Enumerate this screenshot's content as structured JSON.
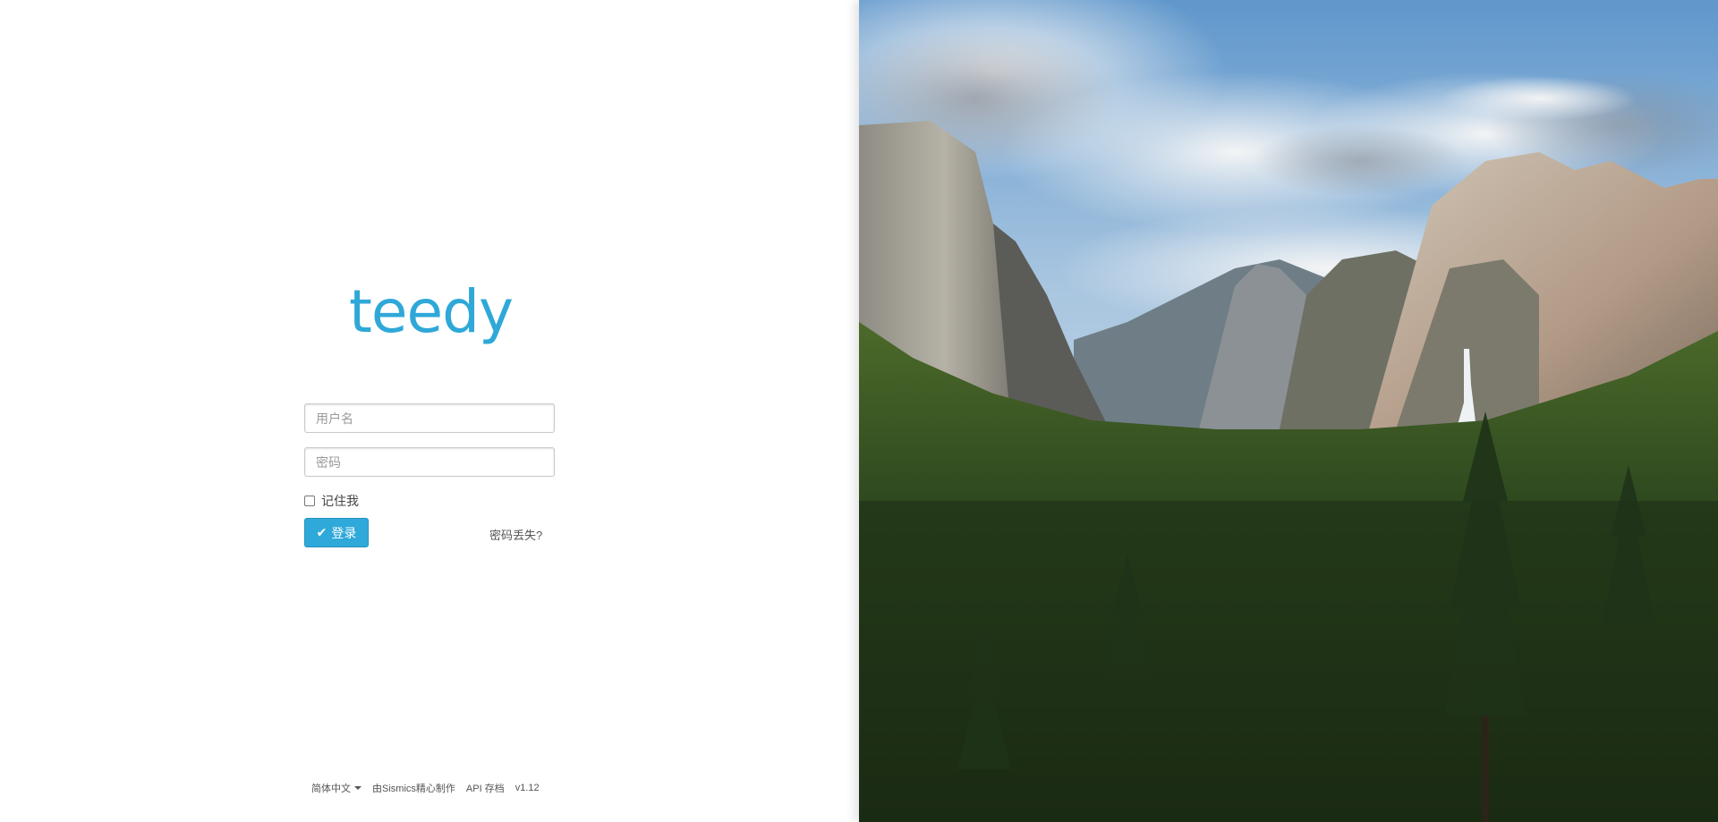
{
  "logo": {
    "text": "teedy"
  },
  "form": {
    "username_placeholder": "用户名",
    "password_placeholder": "密码",
    "remember_label": "记住我",
    "login_label": "登录",
    "forgot_label": "密码丢失?"
  },
  "footer": {
    "language": "简体中文",
    "made_by": "由Sismics精心制作",
    "api_docs": "API 存档",
    "version": "v1.12"
  },
  "colors": {
    "brand": "#2fa8d8",
    "button": "#2fa9d9"
  },
  "icons": {
    "login_icon": "check-icon",
    "language_caret": "caret-down-icon"
  }
}
